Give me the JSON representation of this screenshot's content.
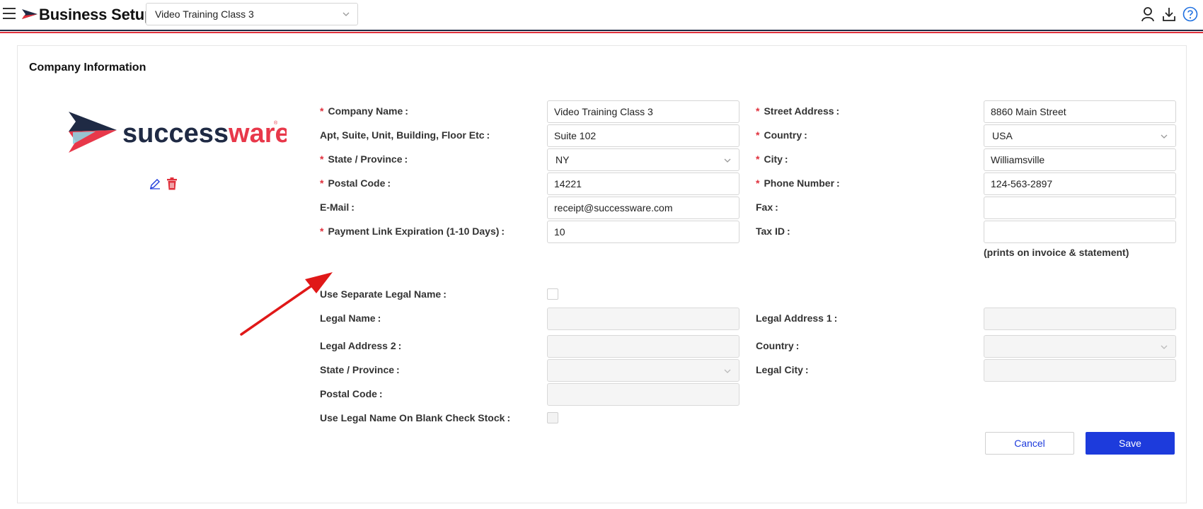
{
  "header": {
    "app_title": "Business Setup",
    "company_selector_value": "Video Training Class 3",
    "icons": [
      "menu-icon",
      "brand-arrow-icon",
      "user-icon",
      "download-icon",
      "help-icon"
    ]
  },
  "card": {
    "title": "Company Information",
    "logo_text": "successware",
    "logo_text_dark": "success",
    "logo_text_red": "ware"
  },
  "colors": {
    "accent": "#1d3bdc",
    "required": "#e0303c",
    "brand_navy": "#1f2a44",
    "brand_red": "#e0303c"
  },
  "form": {
    "company_name": {
      "label": "Company Name",
      "required": true,
      "value": "Video Training Class 3"
    },
    "apt_suite": {
      "label": "Apt, Suite, Unit, Building, Floor Etc",
      "required": false,
      "value": "Suite 102"
    },
    "state_province": {
      "label": "State / Province",
      "required": true,
      "value": "NY"
    },
    "postal_code": {
      "label": "Postal Code",
      "required": true,
      "value": "14221"
    },
    "email": {
      "label": "E-Mail",
      "required": false,
      "value": "receipt@successware.com"
    },
    "payment_link_expiration": {
      "label": "Payment Link Expiration (1-10 Days)",
      "required": true,
      "value": "10"
    },
    "street_address": {
      "label": "Street Address",
      "required": true,
      "value": "8860 Main Street"
    },
    "country": {
      "label": "Country",
      "required": true,
      "value": "USA"
    },
    "city": {
      "label": "City",
      "required": true,
      "value": "Williamsville"
    },
    "phone_number": {
      "label": "Phone Number",
      "required": true,
      "value": "124-563-2897"
    },
    "fax": {
      "label": "Fax",
      "required": false,
      "value": ""
    },
    "tax_id": {
      "label": "Tax ID",
      "required": false,
      "value": ""
    },
    "tax_id_hint": "(prints on invoice & statement)",
    "use_separate_legal_name": {
      "label": "Use Separate Legal Name",
      "checked": false
    },
    "legal_name": {
      "label": "Legal Name",
      "value": ""
    },
    "legal_address_1": {
      "label": "Legal Address 1",
      "value": ""
    },
    "legal_address_2": {
      "label": "Legal Address 2",
      "value": ""
    },
    "legal_country": {
      "label": "Country",
      "value": ""
    },
    "legal_state_province": {
      "label": "State / Province",
      "value": ""
    },
    "legal_city": {
      "label": "Legal City",
      "value": ""
    },
    "legal_postal_code": {
      "label": "Postal Code",
      "value": ""
    },
    "use_legal_name_on_check": {
      "label": "Use Legal Name On Blank Check Stock",
      "checked": false
    }
  },
  "actions": {
    "cancel_label": "Cancel",
    "save_label": "Save"
  }
}
